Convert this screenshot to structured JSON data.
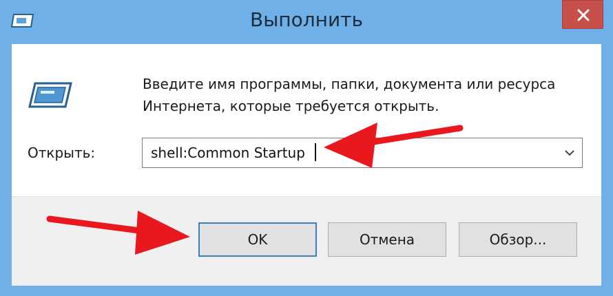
{
  "window": {
    "title": "Выполнить",
    "accent_color": "#6fb0e8",
    "close_button_color": "#c7504b"
  },
  "icons": {
    "app_icon": "run-app-icon",
    "run_icon": "run-program-icon",
    "close_icon": "close-icon",
    "dropdown_icon": "chevron-down-icon"
  },
  "dialog": {
    "description_line1": "Введите имя программы, папки, документа или ресурса",
    "description_line2": "Интернета, которые требуется открыть.",
    "open_label": "Открыть:",
    "command_value": "shell:Common Startup"
  },
  "buttons": {
    "ok": "OK",
    "cancel": "Отмена",
    "browse": "Обзор..."
  },
  "annotations": {
    "arrow_color": "#e8181e"
  }
}
